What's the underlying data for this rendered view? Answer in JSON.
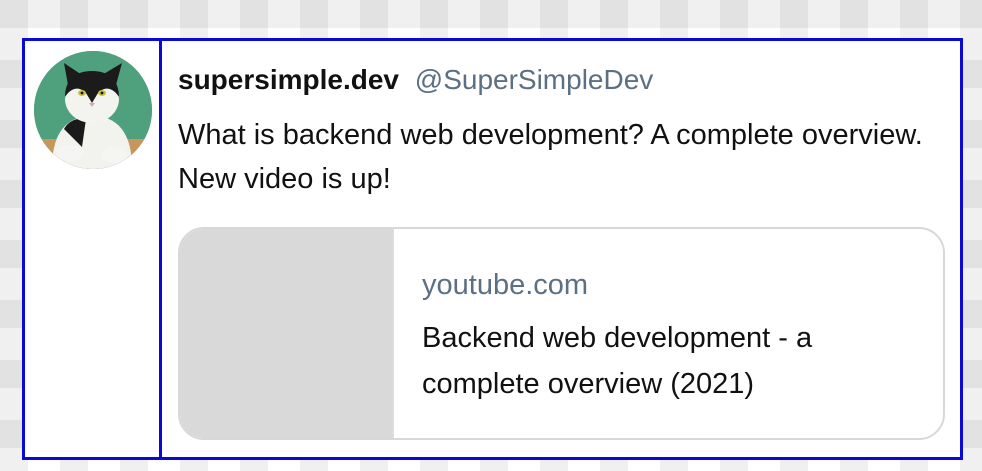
{
  "tweet": {
    "display_name": "supersimple.dev",
    "handle": "@SuperSimpleDev",
    "text": "What is backend web development? A complete overview. New video is up!",
    "avatar": "cat-avatar"
  },
  "link_card": {
    "domain": "youtube.com",
    "title": "Backend web development - a complete overview (2021)"
  },
  "colors": {
    "outline": "#0a0ad6",
    "handle": "#5b7083",
    "text": "#111111",
    "thumbnail": "#d9d9d9",
    "avatar_bg": "#4fa07d"
  }
}
